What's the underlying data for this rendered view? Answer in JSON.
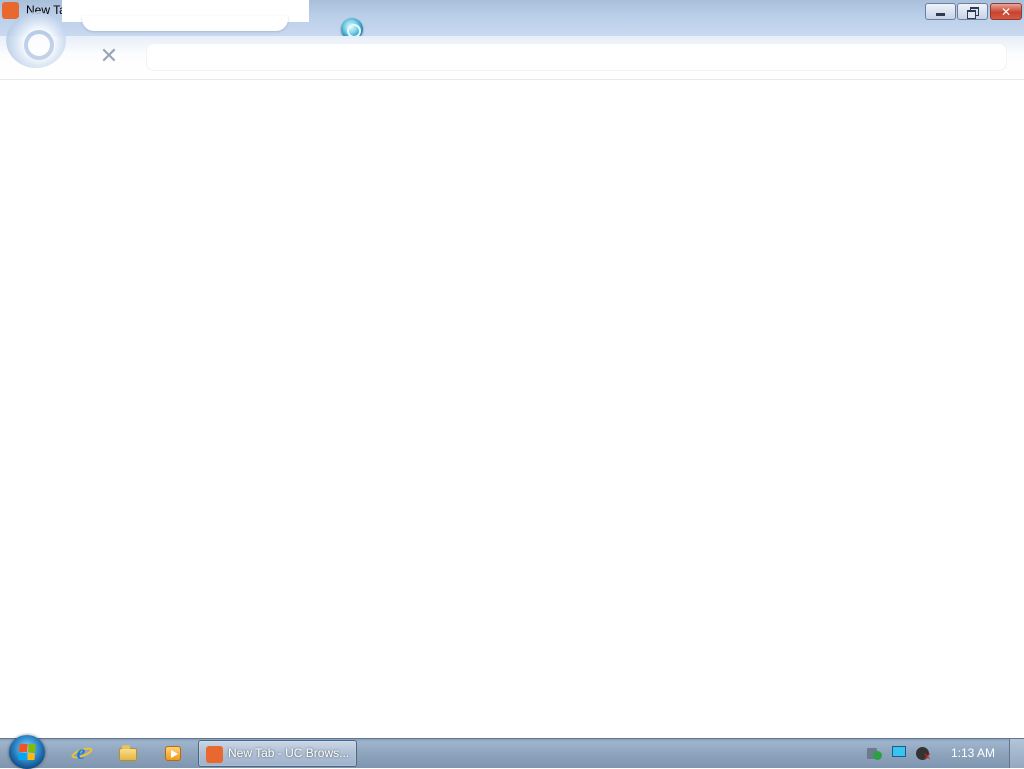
{
  "window": {
    "title": "New Tab"
  },
  "tab": {
    "title": ""
  },
  "address_bar": {
    "value": "",
    "placeholder": ""
  },
  "toolbar": {
    "stop_glyph": "✕"
  },
  "window_controls": {
    "close_glyph": "✕"
  },
  "taskbar": {
    "active_task_label": "New Tab - UC Brows...",
    "pinned": [
      "internet-explorer-icon",
      "windows-explorer-icon",
      "media-player-icon"
    ],
    "tray_icons": [
      "action-center-icon",
      "network-icon",
      "volume-muted-icon"
    ],
    "clock": "1:13 AM"
  },
  "colors": {
    "titlebar": "#bcd0ea",
    "taskbar": "#8ea4bd",
    "uc_orange": "#e8682f",
    "close_red": "#c8432f"
  }
}
